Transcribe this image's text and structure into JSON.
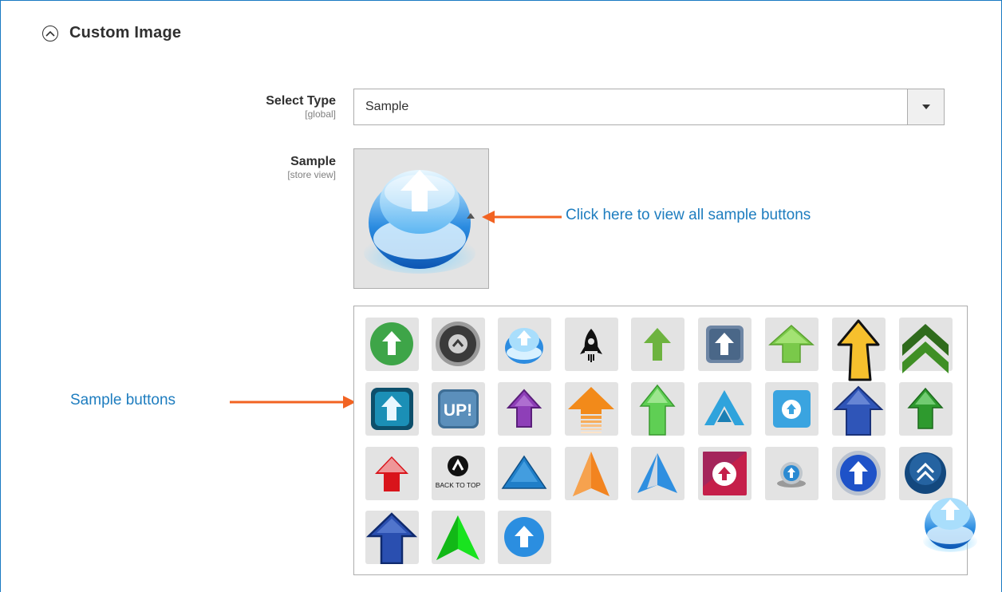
{
  "section": {
    "title": "Custom Image",
    "toggle_icon": "chevron-up-circle-icon"
  },
  "select_type": {
    "label": "Select Type",
    "scope": "[global]",
    "value": "Sample",
    "arrow_icon": "caret-down-icon"
  },
  "sample": {
    "label": "Sample",
    "scope": "[store view]",
    "preview_icon": "glossy-blue-bubble-arrow-icon"
  },
  "annotations": {
    "preview_hint": "Click here to view all sample buttons",
    "grid_hint": "Sample buttons",
    "arrow_color": "#f26322",
    "text_color": "#1e7dbf"
  },
  "sample_buttons": [
    {
      "name": "green-circle-arrow-icon"
    },
    {
      "name": "silver-circle-chevron-icon"
    },
    {
      "name": "glossy-blue-bubble-arrow-icon"
    },
    {
      "name": "black-rocket-icon"
    },
    {
      "name": "green-arrow-icon"
    },
    {
      "name": "slate-square-arrow-icon"
    },
    {
      "name": "lime-glossy-arrow-icon"
    },
    {
      "name": "yellow-sketch-arrow-icon"
    },
    {
      "name": "green-double-chevron-icon"
    },
    {
      "name": "teal-square-arrow-icon"
    },
    {
      "name": "up-badge-icon",
      "text": "UP!"
    },
    {
      "name": "purple-arrow-icon"
    },
    {
      "name": "orange-striped-arrow-icon"
    },
    {
      "name": "light-green-arrow-icon"
    },
    {
      "name": "blue-chevron-a-icon"
    },
    {
      "name": "sky-square-circle-arrow-icon"
    },
    {
      "name": "blue-3d-arrow-icon"
    },
    {
      "name": "green-3d-arrow-icon"
    },
    {
      "name": "red-arrow-icon"
    },
    {
      "name": "back-to-top-icon",
      "text": "BACK TO TOP"
    },
    {
      "name": "blue-triangle-icon"
    },
    {
      "name": "orange-pointer-icon"
    },
    {
      "name": "paper-plane-arrow-icon"
    },
    {
      "name": "red-square-circle-arrow-icon"
    },
    {
      "name": "blue-orb-arrow-icon"
    },
    {
      "name": "blue-ring-arrow-icon"
    },
    {
      "name": "navy-double-chevron-orb-icon"
    },
    {
      "name": "navy-outline-arrow-icon"
    },
    {
      "name": "neon-green-pointer-icon"
    },
    {
      "name": "blue-circle-arrow-icon"
    }
  ],
  "floating_button": {
    "name": "glossy-blue-bubble-arrow-icon"
  }
}
